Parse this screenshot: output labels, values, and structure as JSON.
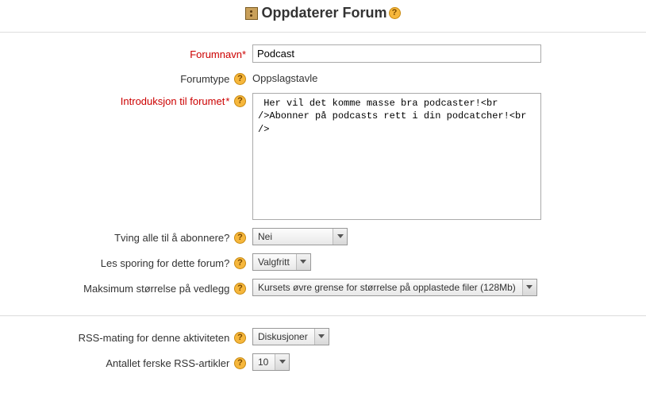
{
  "header": {
    "title": "Oppdaterer Forum"
  },
  "fields": {
    "name": {
      "label": "Forumnavn",
      "value": "Podcast"
    },
    "type": {
      "label": "Forumtype",
      "value": "Oppslagstavle"
    },
    "intro": {
      "label": "Introduksjon til forumet",
      "value": " Her vil det komme masse bra podcaster!<br />Abonner på podcasts rett i din podcatcher!<br />"
    },
    "subscribe": {
      "label": "Tving alle til å abonnere?",
      "value": "Nei"
    },
    "tracking": {
      "label": "Les sporing for dette forum?",
      "value": "Valgfritt"
    },
    "maxsize": {
      "label": "Maksimum størrelse på vedlegg",
      "value": "Kursets øvre grense for størrelse på opplastede filer (128Mb)"
    },
    "rssfeed": {
      "label": "RSS-mating for denne aktiviteten",
      "value": "Diskusjoner"
    },
    "rsscount": {
      "label": "Antallet ferske RSS-artikler",
      "value": "10"
    }
  }
}
